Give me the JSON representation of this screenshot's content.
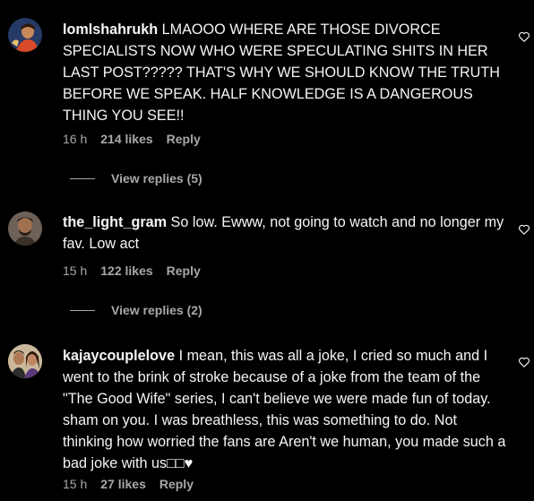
{
  "comments": [
    {
      "username": "lomlshahrukh",
      "text": "LMAOOO WHERE ARE THOSE DIVORCE SPECIALISTS NOW WHO WERE SPECULATING SHITS IN HER LAST POST????? THAT'S WHY WE SHOULD KNOW THE TRUTH BEFORE WE SPEAK. HALF KNOWLEDGE IS A DANGEROUS THING YOU SEE!!",
      "time": "16 h",
      "likes": "214 likes",
      "reply_label": "Reply",
      "view_replies": "View replies (5)"
    },
    {
      "username": "the_light_gram",
      "text": "So low. Ewww, not going to watch and no longer my fav. Low act",
      "time": "15 h",
      "likes": "122 likes",
      "reply_label": "Reply",
      "view_replies": "View replies (2)"
    },
    {
      "username": "kajaycouplelove",
      "text": "I mean, this was all a joke, I cried so much and I went to the brink of stroke because of a joke from the team of the \"The Good Wife\" series, I can't believe we were made fun of today. sham on you. I was breathless, this was something to do. Not thinking how worried the fans are Aren't we human, you made such a bad joke with us□□♥",
      "time": "15 h",
      "likes": "27 likes",
      "reply_label": "Reply"
    }
  ],
  "icons": {
    "like": "heart-outline-icon"
  },
  "colors": {
    "background": "#000000",
    "text_primary": "#f5f5f5",
    "text_secondary": "#a8a8a8"
  }
}
